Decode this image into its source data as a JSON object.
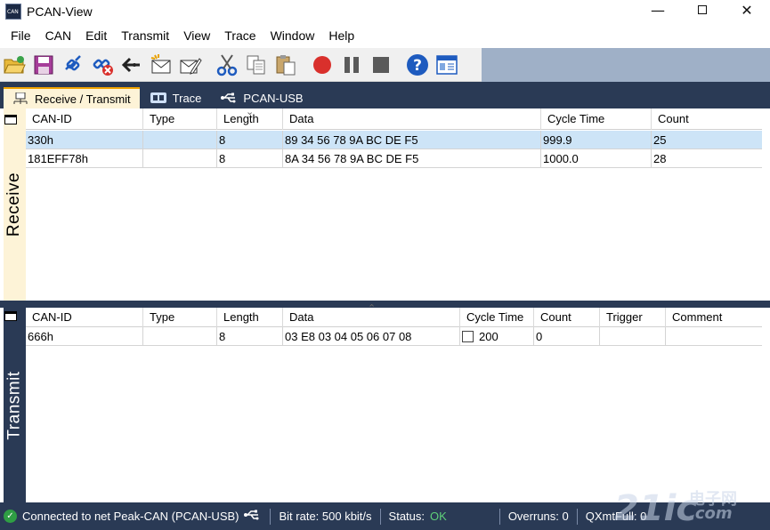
{
  "window": {
    "title": "PCAN-View"
  },
  "menu": [
    "File",
    "CAN",
    "Edit",
    "Transmit",
    "View",
    "Trace",
    "Window",
    "Help"
  ],
  "toolbar": {
    "icons": [
      "open-folder-icon",
      "save-icon",
      "connect-icon",
      "disconnect-icon",
      "reset-icon",
      "new-message-icon",
      "edit-message-icon",
      "cut-icon",
      "copy-icon",
      "paste-icon",
      "record-icon",
      "pause-icon",
      "stop-icon",
      "help-icon",
      "about-icon"
    ]
  },
  "tabs": [
    {
      "label": "Receive / Transmit",
      "active": true,
      "icon": "network-icon"
    },
    {
      "label": "Trace",
      "active": false,
      "icon": "trace-icon"
    },
    {
      "label": "PCAN-USB",
      "active": false,
      "icon": "usb-icon"
    }
  ],
  "receive": {
    "side_label": "Receive",
    "columns": [
      "CAN-ID",
      "Type",
      "Length",
      "Data",
      "Cycle Time",
      "Count"
    ],
    "rows": [
      {
        "can_id": "330h",
        "type": "",
        "length": "8",
        "data": "89 34 56 78 9A BC DE F5",
        "cycle_time": "999.9",
        "count": "25",
        "selected": true
      },
      {
        "can_id": "181EFF78h",
        "type": "",
        "length": "8",
        "data": "8A 34 56 78 9A BC DE F5",
        "cycle_time": "1000.0",
        "count": "28",
        "selected": false
      }
    ]
  },
  "transmit": {
    "side_label": "Transmit",
    "columns": [
      "CAN-ID",
      "Type",
      "Length",
      "Data",
      "Cycle Time",
      "Count",
      "Trigger",
      "Comment"
    ],
    "rows": [
      {
        "can_id": "666h",
        "type": "",
        "length": "8",
        "data": "03 E8 03 04 05 06 07 08",
        "cycle_time": "200",
        "count": "0",
        "trigger": "",
        "comment": "",
        "checked": false
      }
    ]
  },
  "status": {
    "connection": "Connected to net Peak-CAN (PCAN-USB)",
    "bitrate": "Bit rate: 500 kbit/s",
    "status_label": "Status:",
    "status_value": "OK",
    "overruns": "Overruns: 0",
    "qxmtfull": "QXmtFull: 0"
  },
  "colors": {
    "dark_navy": "#2a3a55",
    "side_bg": "#fdf3d7",
    "selected_row": "#cde4f7",
    "status_ok": "#5fd07a"
  },
  "watermark": {
    "brand": "21ic",
    "cn": "电子网",
    "domain": ".com"
  }
}
